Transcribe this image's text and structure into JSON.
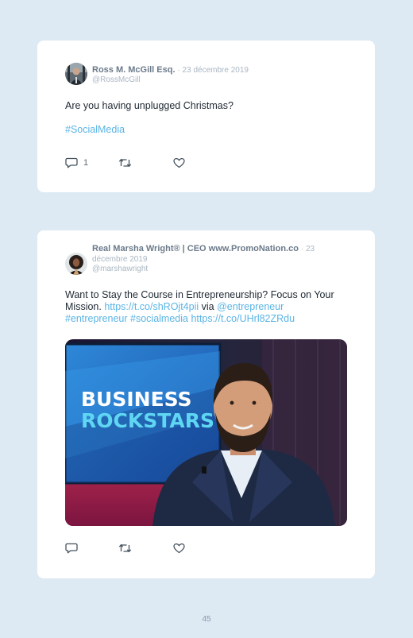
{
  "tweets": [
    {
      "author_name": "Ross M. McGill Esq.",
      "date": "· 23 décembre 2019",
      "handle": "@RossMcGill",
      "text": "Are you having unplugged Christmas?",
      "hashtag": "#SocialMedia",
      "reply_count": "1",
      "icons": [
        "reply-icon",
        "retweet-icon",
        "like-icon"
      ]
    },
    {
      "author_name": "Real Marsha Wright® | CEO www.PromoNation.co",
      "date": "· 23 décembre 2019",
      "handle": "@marshawright",
      "text_part1": "Want to Stay the Course in Entrepreneurship? Focus on Your Mission. ",
      "link1": "https://t.co/shROjt4pii",
      "text_via": " via ",
      "mention": "@entrepreneur",
      "hashtag1": "#entrepreneur",
      "hashtag2": "#socialmedia",
      "link2": "https://t.co/UHrl82ZRdu",
      "media": {
        "line1": "BUSINESS",
        "line2": "ROCKSTARS"
      },
      "icons": [
        "reply-icon",
        "retweet-icon",
        "like-icon"
      ]
    }
  ],
  "page_number": "45",
  "colors": {
    "background": "#dde9f3",
    "card": "#ffffff",
    "link": "#5ab4e5",
    "text": "#1f2933",
    "muted": "#a9b6c3"
  }
}
